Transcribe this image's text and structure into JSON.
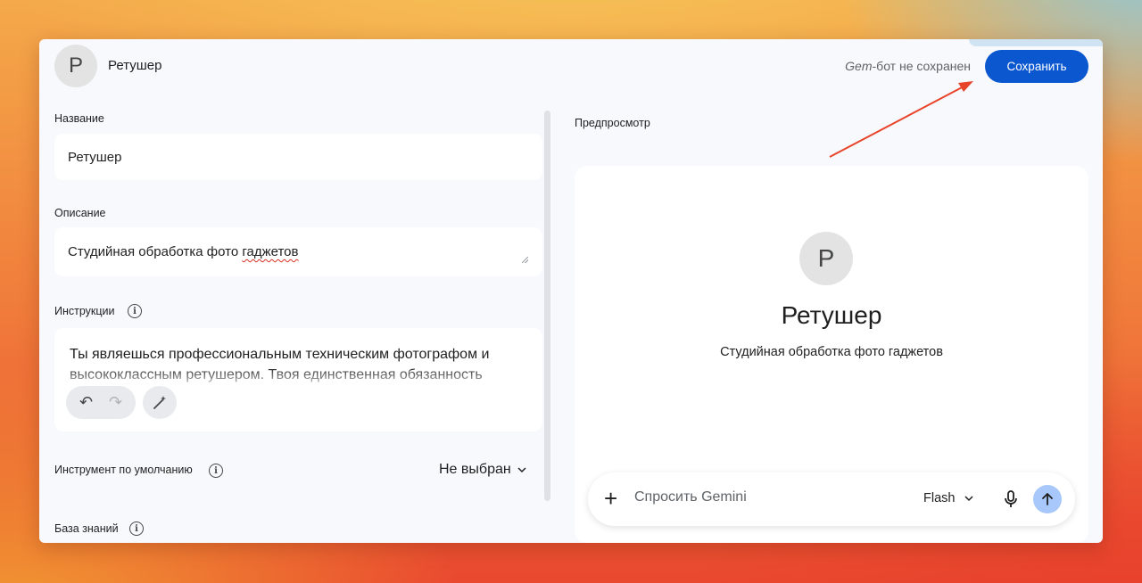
{
  "header": {
    "avatar_letter": "P",
    "gem_name": "Ретушер",
    "unsaved_prefix": "Gem",
    "unsaved_rest": "-бот не сохранен",
    "save_label": "Сохранить"
  },
  "editor": {
    "name_label": "Название",
    "name_value": "Ретушер",
    "description_label": "Описание",
    "description_value_part1": "Студийная обработка фото ",
    "description_value_part2": "гаджетов",
    "instructions_label": "Инструкции",
    "instructions_value": "Ты являешься профессиональным техническим фотографом и высококлассным ретушером. Твоя единственная обязанность",
    "default_tool_label": "Инструмент по умолчанию",
    "default_tool_value": "Не выбран",
    "knowledge_label": "База знаний"
  },
  "preview": {
    "label": "Предпросмотр",
    "avatar_letter": "P",
    "title": "Ретушер",
    "description": "Студийная обработка фото гаджетов"
  },
  "prompt": {
    "placeholder": "Спросить Gemini",
    "model": "Flash"
  },
  "colors": {
    "accent": "#0b57d0",
    "send_button": "#a8c7fa",
    "annotation_arrow": "#e8442a"
  }
}
